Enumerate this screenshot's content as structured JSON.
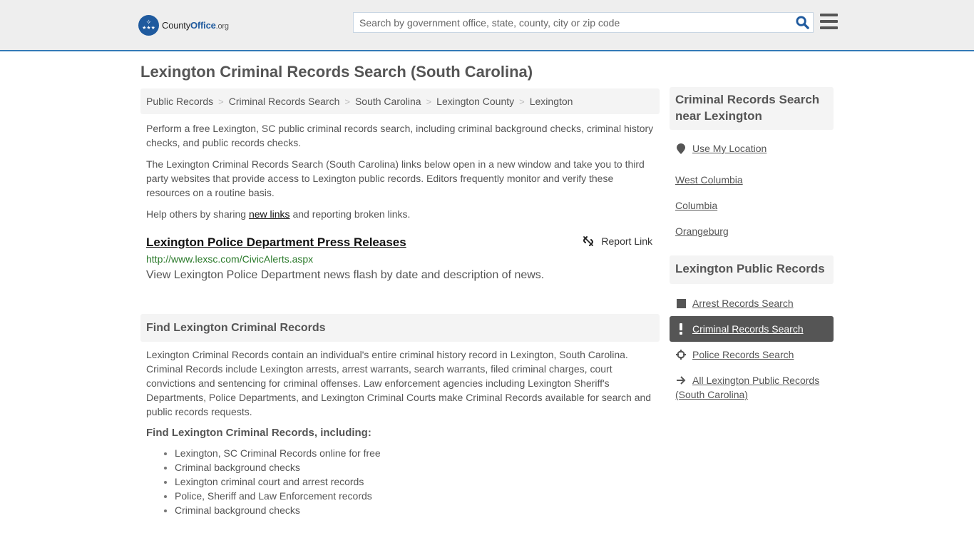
{
  "header": {
    "logo": {
      "name_part1": "County",
      "name_part2": "Office",
      "name_part3": ".org"
    },
    "search": {
      "placeholder": "Search by government office, state, county, city or zip code",
      "value": ""
    },
    "colors": {
      "accent": "#337ab7",
      "brand": "#1f5a9e"
    }
  },
  "page": {
    "title": "Lexington Criminal Records Search (South Carolina)"
  },
  "breadcrumb": [
    {
      "label": "Public Records"
    },
    {
      "label": "Criminal Records Search"
    },
    {
      "label": "South Carolina"
    },
    {
      "label": "Lexington County"
    },
    {
      "label": "Lexington"
    }
  ],
  "intro": {
    "p1": "Perform a free Lexington, SC public criminal records search, including criminal background checks, criminal history checks, and public records checks.",
    "p2": "The Lexington Criminal Records Search (South Carolina) links below open in a new window and take you to third party websites that provide access to Lexington public records. Editors frequently monitor and verify these resources on a routine basis.",
    "p3_before": "Help others by sharing ",
    "p3_link": "new links",
    "p3_after": " and reporting broken links."
  },
  "links": [
    {
      "title": "Lexington Police Department Press Releases",
      "url": "http://www.lexsc.com/CivicAlerts.aspx",
      "description": "View Lexington Police Department news flash by date and description of news.",
      "report_label": "Report Link"
    }
  ],
  "find_section": {
    "heading": "Find Lexington Criminal Records",
    "body": "Lexington Criminal Records contain an individual's entire criminal history record in Lexington, South Carolina. Criminal Records include Lexington arrests, arrest warrants, search warrants, filed criminal charges, court convictions and sentencing for criminal offenses. Law enforcement agencies including Lexington Sheriff's Departments, Police Departments, and Lexington Criminal Courts make Criminal Records available for search and public records requests.",
    "sub_heading": "Find Lexington Criminal Records, including:",
    "bullets": [
      "Lexington, SC Criminal Records online for free",
      "Criminal background checks",
      "Lexington criminal court and arrest records",
      "Police, Sheriff and Law Enforcement records",
      "Criminal background checks"
    ]
  },
  "sidebar": {
    "near": {
      "heading": "Criminal Records Search near Lexington",
      "use_location": {
        "label": "Use My Location",
        "icon": "map-marker-icon"
      },
      "places": [
        "West Columbia",
        "Columbia",
        "Orangeburg"
      ]
    },
    "public_records": {
      "heading": "Lexington Public Records",
      "items": [
        {
          "label": "Arrest Records Search",
          "icon": "square-icon",
          "active": false
        },
        {
          "label": "Criminal Records Search",
          "icon": "exclamation-icon",
          "active": true
        },
        {
          "label": "Police Records Search",
          "icon": "crosshair-icon",
          "active": false
        },
        {
          "label": "All Lexington Public Records (South Carolina)",
          "icon": "arrow-right-icon",
          "active": false
        }
      ]
    }
  }
}
